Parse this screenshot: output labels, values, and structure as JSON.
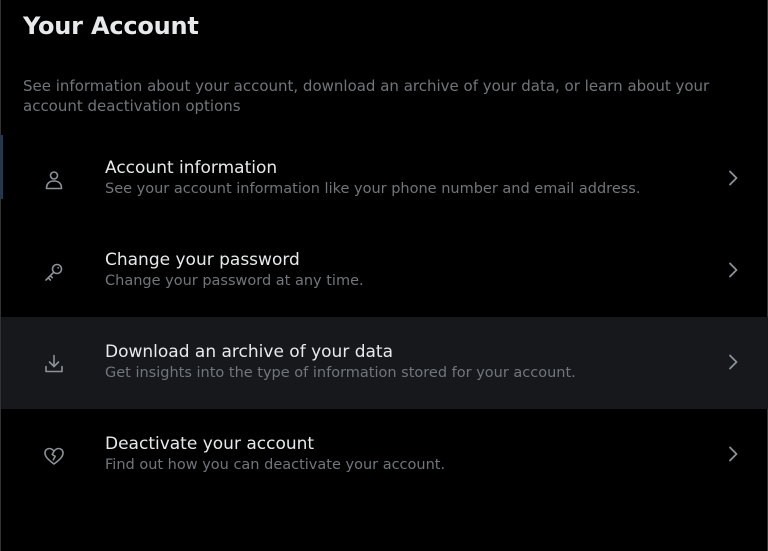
{
  "header": {
    "title": "Your Account",
    "description": "See information about your account, download an archive of your data, or learn about your account deactivation options"
  },
  "menu": {
    "items": [
      {
        "title": "Account information",
        "subtitle": "See your account information like your phone number and email address.",
        "icon": "person-icon"
      },
      {
        "title": "Change your password",
        "subtitle": "Change your password at any time.",
        "icon": "key-icon"
      },
      {
        "title": "Download an archive of your data",
        "subtitle": "Get insights into the type of information stored for your account.",
        "icon": "download-icon"
      },
      {
        "title": "Deactivate your account",
        "subtitle": "Find out how you can deactivate your account.",
        "icon": "broken-heart-icon"
      }
    ]
  },
  "colors": {
    "background": "#000000",
    "text_primary": "#e7e9ea",
    "text_secondary": "#71767b",
    "hover_row": "#16181c"
  }
}
